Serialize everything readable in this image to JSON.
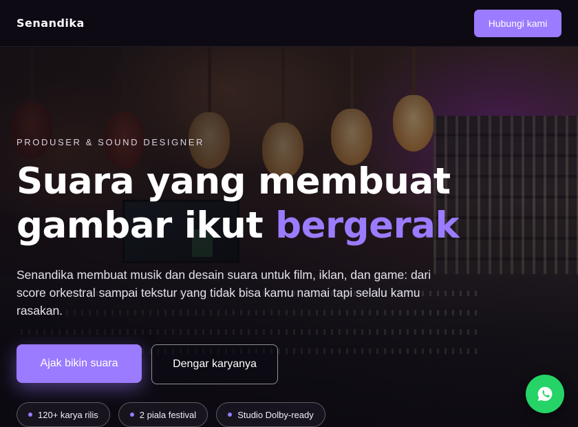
{
  "header": {
    "logo": "Senandika",
    "contact_label": "Hubungi kami"
  },
  "hero": {
    "eyebrow": "PRODUSER & SOUND DESIGNER",
    "headline_line1": "Suara yang membuat",
    "headline_line2_plain": "gambar ikut ",
    "headline_line2_accent": "bergerak",
    "lead": "Senandika membuat musik dan desain suara untuk film, iklan, dan game: dari score orkestral sampai tekstur yang tidak bisa kamu namai tapi selalu kamu rasakan.",
    "primary_cta": "Ajak bikin suara",
    "secondary_cta": "Dengar karyanya",
    "pills": [
      {
        "label": "120+ karya rilis"
      },
      {
        "label": "2 piala festival"
      },
      {
        "label": "Studio Dolby-ready"
      }
    ]
  },
  "fab": {
    "icon": "whatsapp-icon"
  },
  "colors": {
    "accent": "#9b7bff",
    "header_bg": "#0d0a14",
    "whatsapp": "#25d366"
  }
}
